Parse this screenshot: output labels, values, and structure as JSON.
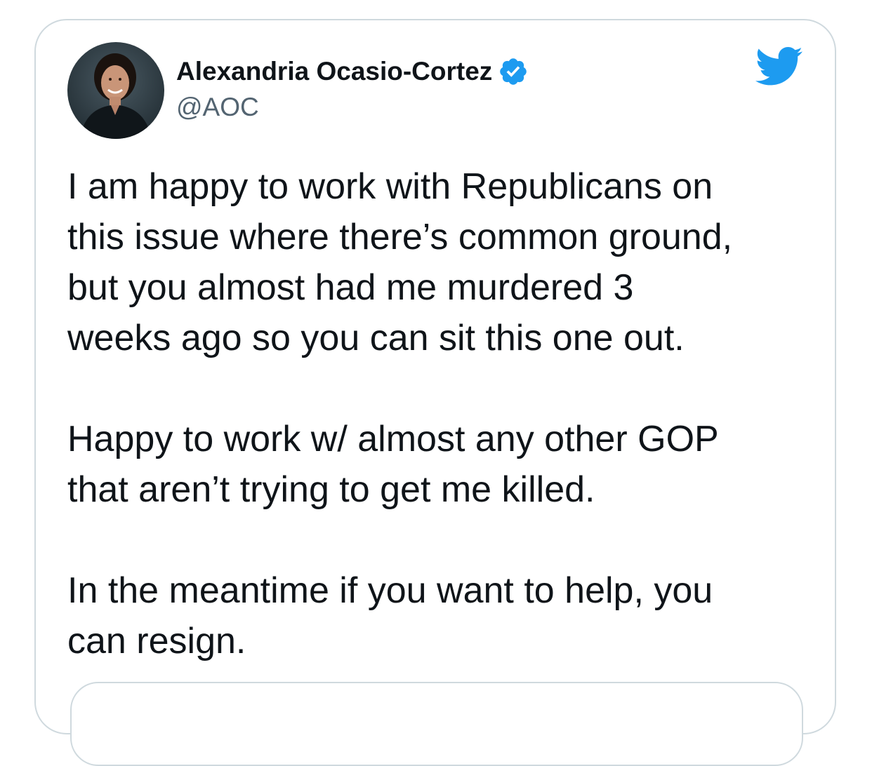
{
  "tweet": {
    "author": {
      "name": "Alexandria Ocasio-Cortez",
      "handle": "@AOC",
      "verified": true,
      "avatar_icon": "profile-photo"
    },
    "brand_icon": "twitter-bird-icon",
    "colors": {
      "brand_blue": "#1d9bf0",
      "text": "#0f1419",
      "secondary_text": "#536471",
      "border": "#cfd9de"
    },
    "paragraphs": [
      {
        "lines": [
          "I am happy to work with Republicans on",
          "this issue where there’s common ground,",
          "but you almost had me murdered 3",
          "weeks ago so you can sit this one out."
        ]
      },
      {
        "lines": [
          "Happy to work w/ almost any other GOP",
          "that aren’t trying to get me killed."
        ]
      },
      {
        "lines": [
          "In the meantime if you want to help, you",
          "can resign."
        ]
      }
    ]
  }
}
